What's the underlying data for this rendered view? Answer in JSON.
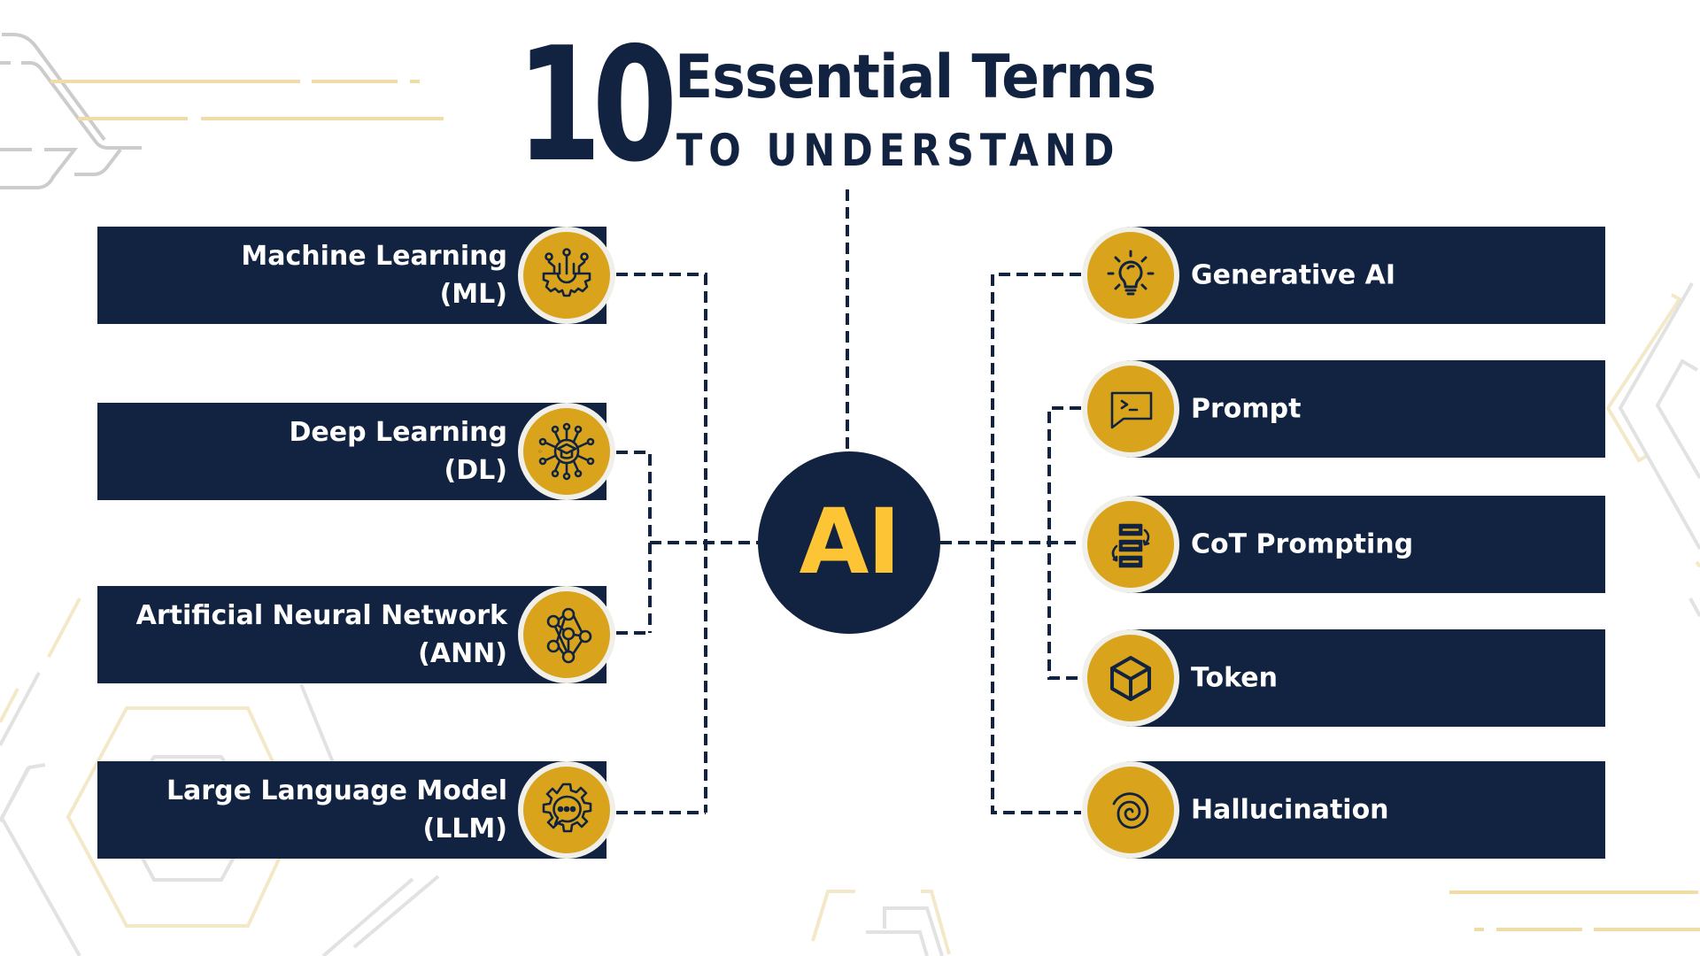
{
  "title": {
    "number": "10",
    "main": "Essential Terms",
    "sub": "TO UNDERSTAND"
  },
  "center": {
    "label": "AI"
  },
  "colors": {
    "navy": "#112340",
    "gold": "#d9a41c",
    "ai_text": "#fdc436",
    "ring": "#f1efea",
    "deco_gray": "#d0d0d0",
    "deco_gold": "#efdca6"
  },
  "left_terms": [
    {
      "line1": "Machine Learning",
      "line2": "(ML)",
      "icon": "gear-circuit-icon"
    },
    {
      "line1": "Deep Learning",
      "line2": "(DL)",
      "icon": "graduation-network-icon"
    },
    {
      "line1": "Artificial Neural Network",
      "line2": "(ANN)",
      "icon": "neural-network-icon"
    },
    {
      "line1": "Large Language Model",
      "line2": "(LLM)",
      "icon": "gear-chat-icon"
    }
  ],
  "right_terms": [
    {
      "label": "Generative AI",
      "icon": "lightbulb-icon"
    },
    {
      "label": "Prompt",
      "icon": "terminal-chat-icon"
    },
    {
      "label": "CoT Prompting",
      "icon": "chain-steps-icon"
    },
    {
      "label": "Token",
      "icon": "cube-icon"
    },
    {
      "label": "Hallucination",
      "icon": "spiral-icon"
    }
  ]
}
